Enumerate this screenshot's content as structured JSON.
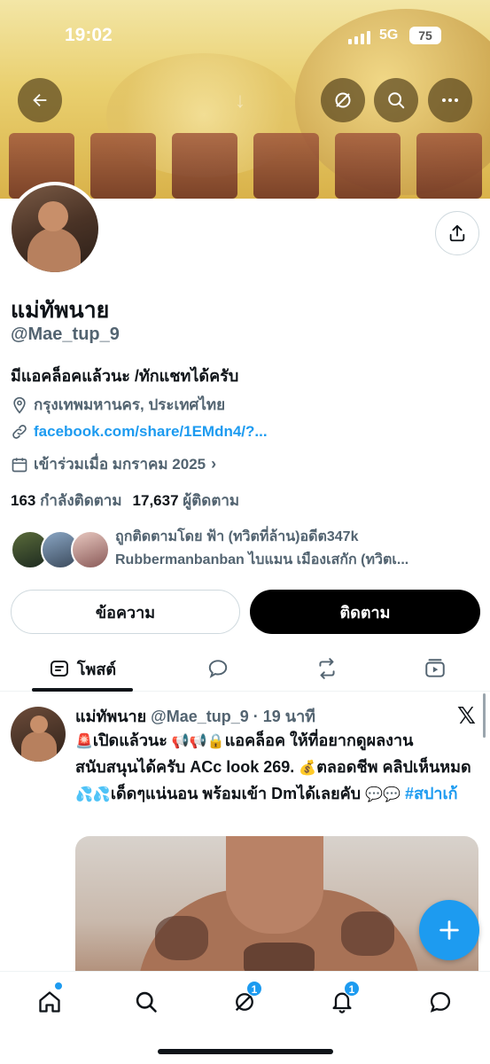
{
  "status_bar": {
    "time": "19:02",
    "network": "5G",
    "battery": "75"
  },
  "profile": {
    "name": "แม่ทัพนาย",
    "handle": "@Mae_tup_9",
    "bio": "มีแอคล็อคแล้วนะ /ทักแชทได้ครับ",
    "location": "กรุงเทพมหานคร, ประเทศไทย",
    "link": "facebook.com/share/1EMdn4/?...",
    "joined": "เข้าร่วมเมื่อ มกราคม 2025",
    "following_count": "163",
    "following_label": "กำลังติดตาม",
    "followers_count": "17,637",
    "followers_label": "ผู้ติดตาม",
    "followed_by_line1": "ถูกติดตามโดย ฟ้า (ทวิตที่ล้าน)อดีต347k",
    "followed_by_line2": "Rubbermanbanban ไบแมน เมืองเสกัก (ทวิตเ..."
  },
  "buttons": {
    "message": "ข้อความ",
    "follow": "ติดตาม"
  },
  "tabs": {
    "posts": "โพสต์"
  },
  "post": {
    "author": "แม่ทัพนาย",
    "handle_time": "@Mae_tup_9 · 19 นาที",
    "text_a": "เปิดแล้วนะ",
    "text_b": "แอคล็อค ให้ที่อยากดูผลงาน สนับสนุนได้ครับ ACc look 269.",
    "text_c": "ตลอดชีพ คลิปเห็นหมด",
    "text_d": "เด็ดๆแน่นอน พร้อมเข้า Dmได้เลยคับ",
    "hashtag": "#สปาเก้"
  },
  "nav": {
    "grok_badge": "1",
    "notifications_badge": "1"
  },
  "colors": {
    "accent": "#1d9bf0",
    "text": "#0f1419",
    "muted": "#536471"
  }
}
